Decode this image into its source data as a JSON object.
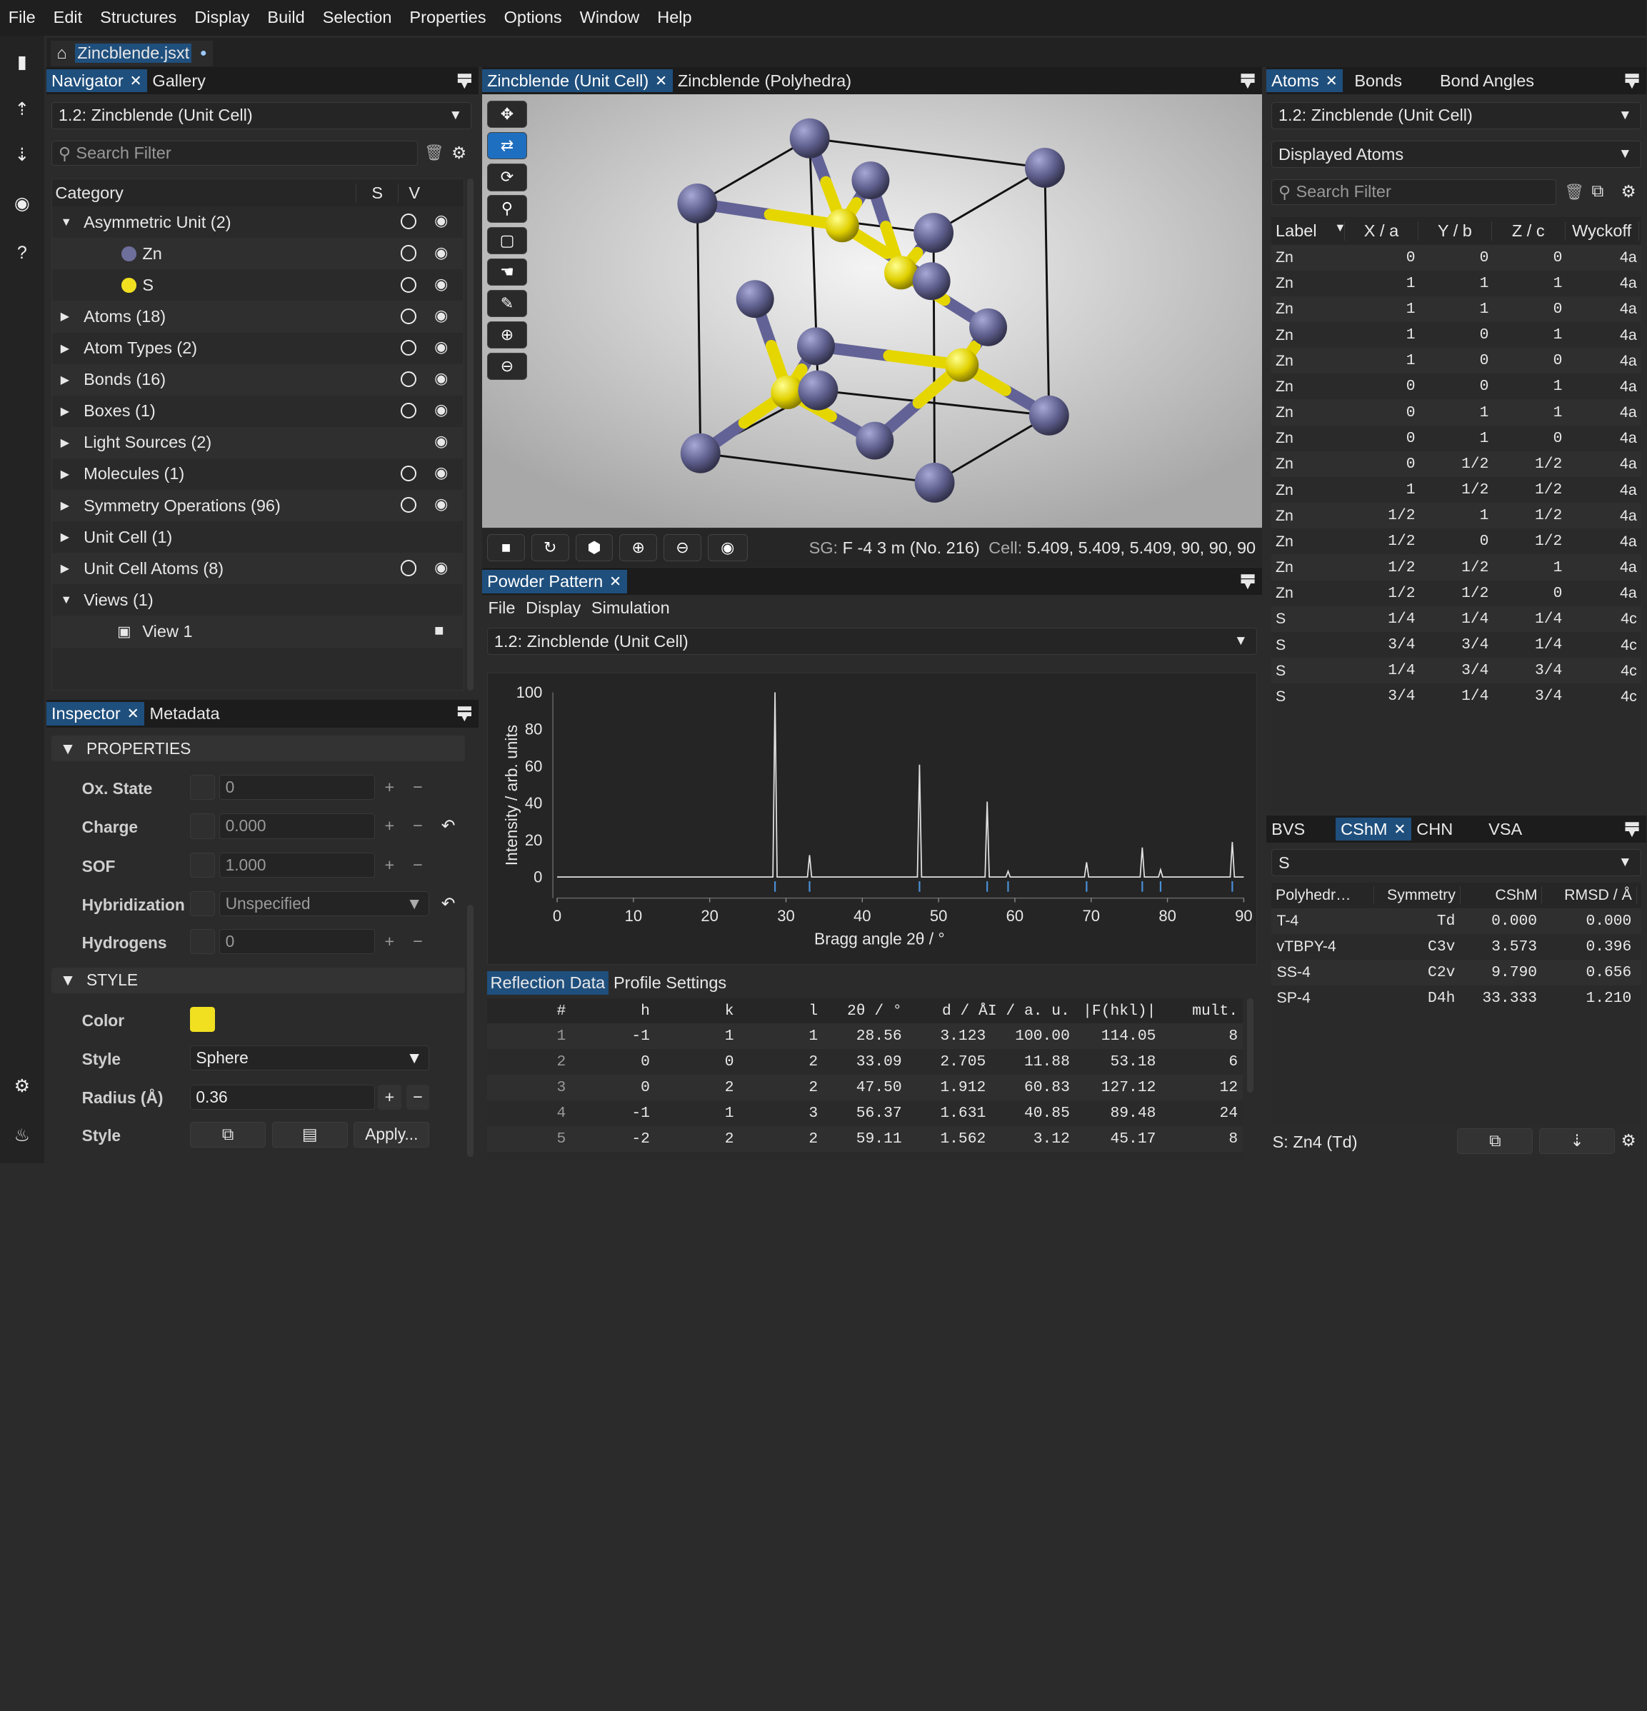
{
  "menu": [
    "File",
    "Edit",
    "Structures",
    "Display",
    "Build",
    "Selection",
    "Properties",
    "Options",
    "Window",
    "Help"
  ],
  "file_tab": {
    "label": "Zincblende.jsxt",
    "modified": "●"
  },
  "navigator": {
    "tabs": [
      "Navigator",
      "Gallery"
    ],
    "structure": "1.2: Zincblende (Unit Cell)",
    "search_placeholder": "Search Filter",
    "cols": {
      "category": "Category",
      "s": "S",
      "v": "V"
    },
    "rows": [
      {
        "label": "Asymmetric Unit (2)",
        "arrow": "▼",
        "indent": 0,
        "s": true,
        "v": true
      },
      {
        "label": "Zn",
        "indent": 1,
        "dot": "#6f6f9c",
        "s": true,
        "v": true
      },
      {
        "label": "S",
        "indent": 1,
        "dot": "#f0e020",
        "s": true,
        "v": true
      },
      {
        "label": "Atoms (18)",
        "arrow": "▶",
        "indent": 0,
        "s": true,
        "v": true
      },
      {
        "label": "Atom Types (2)",
        "arrow": "▶",
        "indent": 0,
        "s": true,
        "v": true
      },
      {
        "label": "Bonds (16)",
        "arrow": "▶",
        "indent": 0,
        "s": true,
        "v": true
      },
      {
        "label": "Boxes (1)",
        "arrow": "▶",
        "indent": 0,
        "s": true,
        "v": true
      },
      {
        "label": "Light Sources (2)",
        "arrow": "▶",
        "indent": 0,
        "s": false,
        "v": true
      },
      {
        "label": "Molecules (1)",
        "arrow": "▶",
        "indent": 0,
        "s": true,
        "v": true
      },
      {
        "label": "Symmetry Operations (96)",
        "arrow": "▶",
        "indent": 0,
        "s": true,
        "v": true
      },
      {
        "label": "Unit Cell (1)",
        "arrow": "▶",
        "indent": 0,
        "s": false,
        "v": false
      },
      {
        "label": "Unit Cell Atoms (8)",
        "arrow": "▶",
        "indent": 0,
        "s": true,
        "v": true
      },
      {
        "label": "Views (1)",
        "arrow": "▼",
        "indent": 0,
        "s": false,
        "v": false
      },
      {
        "label": "View 1",
        "indent": 1,
        "view": true,
        "s": false,
        "v": false
      }
    ]
  },
  "inspector": {
    "tabs": [
      "Inspector",
      "Metadata"
    ],
    "sections": {
      "properties": "PROPERTIES",
      "style": "STYLE"
    },
    "ox_state": {
      "label": "Ox. State",
      "value": "0"
    },
    "charge": {
      "label": "Charge",
      "value": "0.000"
    },
    "sof": {
      "label": "SOF",
      "value": "1.000"
    },
    "hybridization": {
      "label": "Hybridization",
      "value": "Unspecified"
    },
    "hydrogens": {
      "label": "Hydrogens",
      "value": "0"
    },
    "color": {
      "label": "Color",
      "value": "#f0e020"
    },
    "style": {
      "label": "Style",
      "value": "Sphere"
    },
    "radius": {
      "label": "Radius (Å)",
      "value": "0.36"
    },
    "style2": {
      "label": "Style",
      "apply": "Apply..."
    }
  },
  "viewer": {
    "tabs": [
      "Zincblende (Unit Cell)",
      "Zincblende (Polyhedra)"
    ],
    "sg_label": "SG:",
    "sg_value": "F -4 3 m (No. 216)",
    "cell_label": "Cell:",
    "cell_value": "5.409, 5.409, 5.409, 90, 90, 90"
  },
  "powder": {
    "tab": "Powder Pattern",
    "menu": [
      "File",
      "Display",
      "Simulation"
    ],
    "structure": "1.2: Zincblende (Unit Cell)",
    "subtabs": [
      "Reflection Data",
      "Profile Settings"
    ],
    "table_cols": [
      "#",
      "h",
      "k",
      "l",
      "2θ / °",
      "d / ÅI / a. u.",
      "|F(hkl)|",
      "mult."
    ],
    "table_rows": [
      [
        "1",
        "-1",
        "1",
        "1",
        "28.56",
        "3.123",
        "100.00",
        "114.05",
        "8"
      ],
      [
        "2",
        "0",
        "0",
        "2",
        "33.09",
        "2.705",
        "11.88",
        "53.18",
        "6"
      ],
      [
        "3",
        "0",
        "2",
        "2",
        "47.50",
        "1.912",
        "60.83",
        "127.12",
        "12"
      ],
      [
        "4",
        "-1",
        "1",
        "3",
        "56.37",
        "1.631",
        "40.85",
        "89.48",
        "24"
      ],
      [
        "5",
        "-2",
        "2",
        "2",
        "59.11",
        "1.562",
        "3.12",
        "45.17",
        "8"
      ]
    ]
  },
  "chart_data": {
    "type": "line",
    "title": "",
    "xlabel": "Bragg angle 2θ / °",
    "ylabel": "Intensity / arb. units",
    "xlim": [
      0,
      90
    ],
    "ylim": [
      0,
      100
    ],
    "xticks": [
      "0",
      "10",
      "20",
      "30",
      "40",
      "50",
      "60",
      "70",
      "80",
      "90"
    ],
    "yticks": [
      "0",
      "20",
      "40",
      "60",
      "80",
      "100"
    ],
    "peaks": [
      [
        28.56,
        100
      ],
      [
        33.09,
        11.88
      ],
      [
        47.5,
        60.83
      ],
      [
        56.37,
        40.85
      ],
      [
        59.11,
        3.12
      ],
      [
        69.4,
        8
      ],
      [
        76.7,
        16
      ],
      [
        79.1,
        4
      ],
      [
        88.5,
        19
      ]
    ]
  },
  "atoms": {
    "tabs": [
      "Atoms",
      "Bonds",
      "Bond Angles"
    ],
    "structure": "1.2: Zincblende (Unit Cell)",
    "filter": "Displayed Atoms",
    "search_placeholder": "Search Filter",
    "cols": [
      "Label",
      "X / a",
      "Y / b",
      "Z / c",
      "Wyckoff"
    ],
    "rows": [
      [
        "Zn",
        "0",
        "0",
        "0",
        "4a"
      ],
      [
        "Zn",
        "1",
        "1",
        "1",
        "4a"
      ],
      [
        "Zn",
        "1",
        "1",
        "0",
        "4a"
      ],
      [
        "Zn",
        "1",
        "0",
        "1",
        "4a"
      ],
      [
        "Zn",
        "1",
        "0",
        "0",
        "4a"
      ],
      [
        "Zn",
        "0",
        "0",
        "1",
        "4a"
      ],
      [
        "Zn",
        "0",
        "1",
        "1",
        "4a"
      ],
      [
        "Zn",
        "0",
        "1",
        "0",
        "4a"
      ],
      [
        "Zn",
        "0",
        "1/2",
        "1/2",
        "4a"
      ],
      [
        "Zn",
        "1",
        "1/2",
        "1/2",
        "4a"
      ],
      [
        "Zn",
        "1/2",
        "1",
        "1/2",
        "4a"
      ],
      [
        "Zn",
        "1/2",
        "0",
        "1/2",
        "4a"
      ],
      [
        "Zn",
        "1/2",
        "1/2",
        "1",
        "4a"
      ],
      [
        "Zn",
        "1/2",
        "1/2",
        "0",
        "4a"
      ],
      [
        "S",
        "1/4",
        "1/4",
        "1/4",
        "4c"
      ],
      [
        "S",
        "3/4",
        "3/4",
        "1/4",
        "4c"
      ],
      [
        "S",
        "1/4",
        "3/4",
        "3/4",
        "4c"
      ],
      [
        "S",
        "3/4",
        "1/4",
        "3/4",
        "4c"
      ]
    ]
  },
  "cshm": {
    "tabs": [
      "BVS",
      "CShM",
      "CHN",
      "VSA"
    ],
    "site": "S",
    "cols": [
      "Polyhedr…",
      "Symmetry",
      "CShM",
      "RMSD / Å"
    ],
    "rows": [
      [
        "T-4",
        "Td",
        "0.000",
        "0.000"
      ],
      [
        "vTBPY-4",
        "C3v",
        "3.573",
        "0.396"
      ],
      [
        "SS-4",
        "C2v",
        "9.790",
        "0.656"
      ],
      [
        "SP-4",
        "D4h",
        "33.333",
        "1.210"
      ]
    ],
    "status": "S: Zn4 (Td)"
  }
}
